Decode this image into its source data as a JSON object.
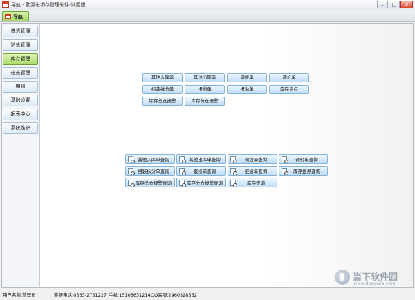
{
  "window": {
    "title": "导航 - 勤源进销存管理软件-试用版",
    "minimize": "–",
    "maximize": "□",
    "close": "✕"
  },
  "tab": {
    "label": "导航"
  },
  "sidebar": {
    "items": [
      {
        "label": "进货管理"
      },
      {
        "label": "销售管理"
      },
      {
        "label": "库存管理"
      },
      {
        "label": "往来管理"
      },
      {
        "label": "期初"
      },
      {
        "label": "基础设置"
      },
      {
        "label": "报表中心"
      },
      {
        "label": "系统维护"
      }
    ],
    "active_index": 2
  },
  "actions": [
    {
      "label": "其他入库单"
    },
    {
      "label": "其他出库单"
    },
    {
      "label": "调拨单"
    },
    {
      "label": "调价单"
    },
    {
      "label": "组装拆分单"
    },
    {
      "label": "报损单"
    },
    {
      "label": "报溢单"
    },
    {
      "label": "库存盘点"
    },
    {
      "label": "库存总仓报警"
    },
    {
      "label": "库存分仓报警"
    }
  ],
  "queries": [
    {
      "label": "其他入库单查询"
    },
    {
      "label": "其他出库单查询"
    },
    {
      "label": "调拨单查询"
    },
    {
      "label": "调价单查询"
    },
    {
      "label": "组装拆分单查询"
    },
    {
      "label": "报损单查询"
    },
    {
      "label": "报溢单查询"
    },
    {
      "label": "库存盘点查询"
    },
    {
      "label": "库存总仓报警查询"
    },
    {
      "label": "库存分仓报警查询"
    },
    {
      "label": "库存查询"
    }
  ],
  "status": {
    "user": "用户名称:管理员",
    "hotline": "客服电话:0563-2731227",
    "mobile": "手机:15105631214",
    "qq": "QQ客服:2960328562"
  },
  "watermark": {
    "title": "当下软件园",
    "url": "www.downxia.com"
  }
}
